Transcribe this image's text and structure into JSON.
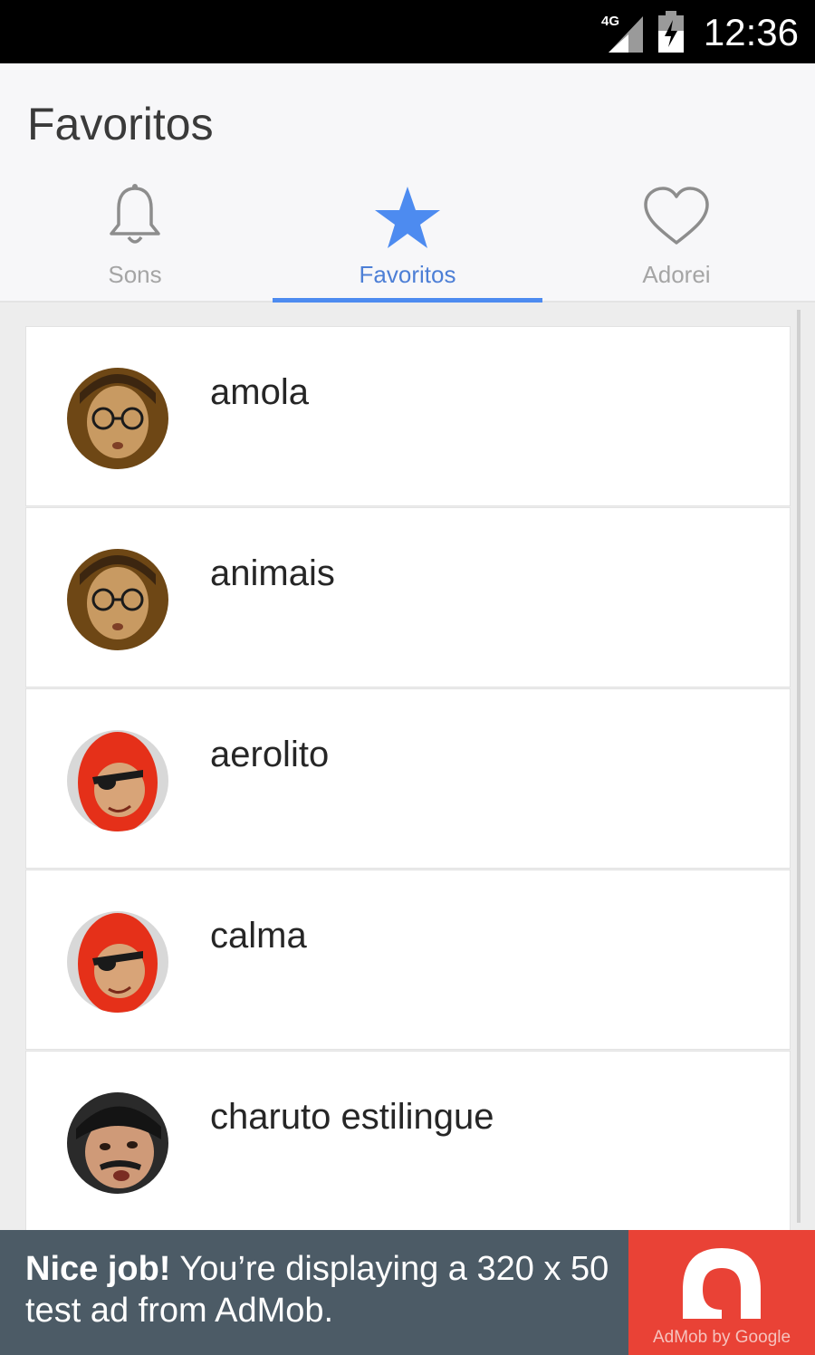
{
  "status_bar": {
    "network": "4G",
    "time": "12:36"
  },
  "app_bar": {
    "title": "Favoritos"
  },
  "tabs": [
    {
      "label": "Sons",
      "icon": "bell-icon",
      "active": false
    },
    {
      "label": "Favoritos",
      "icon": "star-icon",
      "active": true
    },
    {
      "label": "Adorei",
      "icon": "heart-icon",
      "active": false
    }
  ],
  "list": [
    {
      "name": "amola",
      "avatar": "glasses-boy-avatar"
    },
    {
      "name": "animais",
      "avatar": "glasses-boy-avatar"
    },
    {
      "name": "aerolito",
      "avatar": "red-hood-eyepatch-avatar"
    },
    {
      "name": "calma",
      "avatar": "red-hood-eyepatch-avatar"
    },
    {
      "name": "charuto estilingue",
      "avatar": "mustache-man-avatar"
    }
  ],
  "ad": {
    "headline": "Nice job!",
    "body": " You’re displaying a 320 x 50 test ad from AdMob.",
    "logo_caption": "AdMob by Google"
  },
  "colors": {
    "accent": "#4d8bf0",
    "ad_background": "#4c5b66",
    "ad_logo": "#e94236"
  }
}
